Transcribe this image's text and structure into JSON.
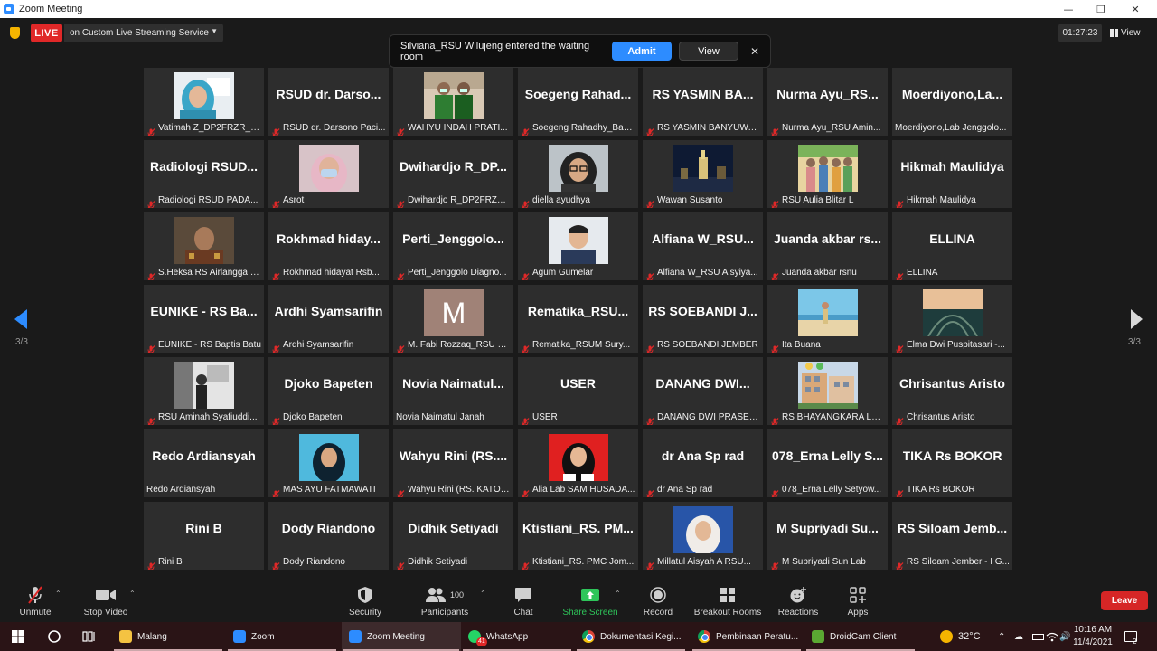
{
  "window": {
    "title": "Zoom Meeting"
  },
  "live": {
    "badge": "LIVE",
    "service": "on Custom Live Streaming Service"
  },
  "timer": "01:27:23",
  "view_label": "View",
  "notice": {
    "text": "Silviana_RSU Wilujeng entered the waiting room",
    "admit": "Admit",
    "view": "View"
  },
  "page": {
    "left": "3/3",
    "right": "3/3"
  },
  "tiles": [
    {
      "name": "",
      "label": "Vatimah Z_DP2FRZR_BAP...",
      "photo": "hijab"
    },
    {
      "name": "RSUD dr. Darso...",
      "label": "RSUD dr. Darsono Paci..."
    },
    {
      "name": "",
      "label": "WAHYU INDAH PRATI...",
      "photo": "two-men"
    },
    {
      "name": "Soegeng Rahad...",
      "label": "Soegeng Rahadhy_Bap..."
    },
    {
      "name": "RS YASMIN BA...",
      "label": "RS YASMIN BANYUWA..."
    },
    {
      "name": "Nurma Ayu_RS...",
      "label": "Nurma Ayu_RSU Amin..."
    },
    {
      "name": "Moerdiyono,La...",
      "label": "Moerdiyono,Lab Jenggolo...",
      "nomute": true
    },
    {
      "name": "Radiologi RSUD...",
      "label": "Radiologi RSUD PADA..."
    },
    {
      "name": "",
      "label": "Asrot",
      "photo": "mask"
    },
    {
      "name": "Dwihardjo R_DP...",
      "label": "Dwihardjo R_DP2FRZR..."
    },
    {
      "name": "",
      "label": "diella ayudhya",
      "photo": "glasses"
    },
    {
      "name": "",
      "label": "Wawan Susanto",
      "photo": "night"
    },
    {
      "name": "",
      "label": "RSU Aulia Blitar L",
      "photo": "group"
    },
    {
      "name": "Hikmah Maulidya",
      "label": "Hikmah Maulidya"
    },
    {
      "name": "",
      "label": "S.Heksa RS Airlangga J...",
      "photo": "man-batik"
    },
    {
      "name": "Rokhmad hiday...",
      "label": "Rokhmad hidayat Rsb..."
    },
    {
      "name": "Perti_Jenggolo...",
      "label": "Perti_Jenggolo Diagno..."
    },
    {
      "name": "",
      "label": "Agum Gumelar",
      "photo": "young-man"
    },
    {
      "name": "Alfiana W_RSU...",
      "label": "Alfiana W_RSU Aisyiya..."
    },
    {
      "name": "Juanda akbar rs...",
      "label": "Juanda akbar rsnu"
    },
    {
      "name": "ELLINA",
      "label": "ELLINA"
    },
    {
      "name": "EUNIKE - RS Ba...",
      "label": "EUNIKE - RS Baptis Batu"
    },
    {
      "name": "Ardhi Syamsarifin",
      "label": "Ardhi Syamsarifin"
    },
    {
      "name": "",
      "label": "M. Fabi Rozzaq_RSU U...",
      "avatar": "M"
    },
    {
      "name": "Rematika_RSU...",
      "label": "Rematika_RSUM Sury..."
    },
    {
      "name": "RS SOEBANDI J...",
      "label": "RS SOEBANDI JEMBER"
    },
    {
      "name": "",
      "label": "Ita Buana",
      "photo": "beach"
    },
    {
      "name": "",
      "label": "Elma Dwi Puspitasari -...",
      "photo": "sunset"
    },
    {
      "name": "",
      "label": "RSU Aminah Syafiuddi...",
      "photo": "bw"
    },
    {
      "name": "Djoko Bapeten",
      "label": "Djoko Bapeten"
    },
    {
      "name": "Novia Naimatul...",
      "label": "Novia Naimatul Janah",
      "nomute": true
    },
    {
      "name": "USER",
      "label": "USER"
    },
    {
      "name": "DANANG DWI...",
      "label": "DANANG DWI PRASET..."
    },
    {
      "name": "",
      "label": "RS BHAYANGKARA LU...",
      "photo": "building"
    },
    {
      "name": "Chrisantus Aristo",
      "label": "Chrisantus Aristo"
    },
    {
      "name": "Redo Ardiansyah",
      "label": "Redo Ardiansyah",
      "nomute": true
    },
    {
      "name": "",
      "label": "MAS AYU FATMAWATI",
      "photo": "hijab-blue"
    },
    {
      "name": "Wahyu Rini (RS....",
      "label": "Wahyu Rini (RS. KATOL..."
    },
    {
      "name": "",
      "label": "Alia Lab SAM HUSADA...",
      "photo": "red-bg"
    },
    {
      "name": "dr Ana Sp rad",
      "label": "dr Ana Sp rad"
    },
    {
      "name": "078_Erna Lelly S...",
      "label": "078_Erna Lelly Setyow..."
    },
    {
      "name": "TIKA Rs BOKOR",
      "label": "TIKA Rs BOKOR"
    },
    {
      "name": "Rini B",
      "label": "Rini B"
    },
    {
      "name": "Dody Riandono",
      "label": "Dody Riandono"
    },
    {
      "name": "Didhik Setiyadi",
      "label": "Didhik Setiyadi"
    },
    {
      "name": "Ktistiani_RS. PM...",
      "label": "Ktistiani_RS. PMC Jom..."
    },
    {
      "name": "",
      "label": "Millatul Aisyah A RSU...",
      "photo": "hijab-white"
    },
    {
      "name": "M Supriyadi Su...",
      "label": "M Supriyadi Sun Lab"
    },
    {
      "name": "RS Siloam Jemb...",
      "label": "RS Siloam Jember - I G..."
    }
  ],
  "toolbar": {
    "unmute": "Unmute",
    "stop_video": "Stop Video",
    "security": "Security",
    "participants": "Participants",
    "participants_count": "100",
    "chat": "Chat",
    "share_screen": "Share Screen",
    "record": "Record",
    "breakout": "Breakout Rooms",
    "reactions": "Reactions",
    "apps": "Apps",
    "leave": "Leave"
  },
  "taskbar": {
    "apps": [
      {
        "label": "Malang",
        "icon": "folder-icon"
      },
      {
        "label": "Zoom",
        "icon": "zoom-icon"
      },
      {
        "label": "Zoom Meeting",
        "icon": "zoom-icon",
        "active": true
      },
      {
        "label": "WhatsApp",
        "icon": "whatsapp-icon",
        "badge": "41"
      },
      {
        "label": "Dokumentasi Kegi...",
        "icon": "chrome-icon"
      },
      {
        "label": "Pembinaan Peratu...",
        "icon": "chrome-icon"
      },
      {
        "label": "DroidCam Client",
        "icon": "droidcam-icon"
      }
    ],
    "temperature": "32°C",
    "time": "10:16 AM",
    "date": "11/4/2021",
    "notif_count": "2"
  },
  "colors": {
    "accent": "#2d8cff",
    "live": "#e02828",
    "leave": "#d62626",
    "share": "#2ec55a"
  }
}
